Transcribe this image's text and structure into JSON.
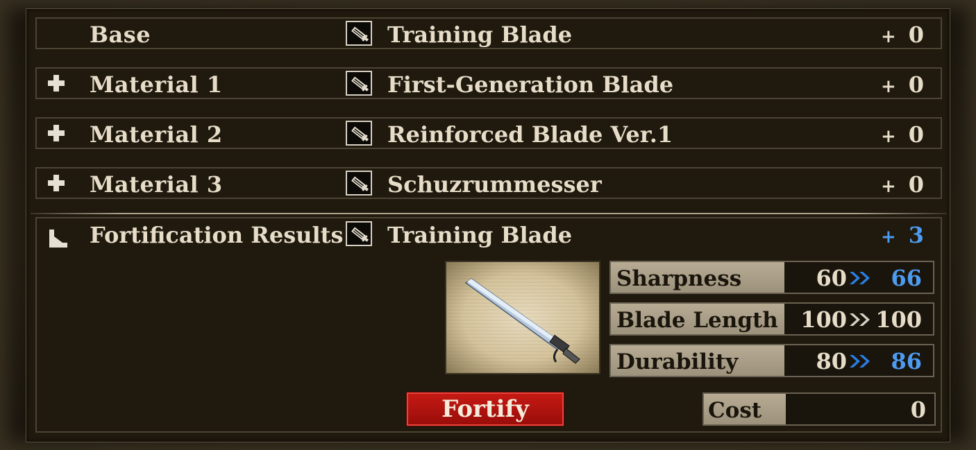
{
  "rows": [
    {
      "label": "Base",
      "name": "Training Blade",
      "plus": "+",
      "level": "0",
      "has_plus_icon": false
    },
    {
      "label": "Material 1",
      "name": "First-Generation Blade",
      "plus": "+",
      "level": "0",
      "has_plus_icon": true
    },
    {
      "label": "Material 2",
      "name": "Reinforced Blade Ver.1",
      "plus": "+",
      "level": "0",
      "has_plus_icon": true
    },
    {
      "label": "Material 3",
      "name": "Schuzrummesser",
      "plus": "+",
      "level": "0",
      "has_plus_icon": true
    }
  ],
  "result": {
    "label": "Fortification Results",
    "name": "Training Blade",
    "plus": "+",
    "level": "3"
  },
  "stats": [
    {
      "label": "Sharpness",
      "from": "60",
      "to": "66",
      "improved": true
    },
    {
      "label": "Blade Length",
      "from": "100",
      "to": "100",
      "improved": false
    },
    {
      "label": "Durability",
      "from": "80",
      "to": "86",
      "improved": true
    }
  ],
  "fortify_label": "Fortify",
  "cost": {
    "label": "Cost",
    "value": "0"
  },
  "colors": {
    "improved": "#4d9bf0",
    "neutral": "#e6dcc8",
    "button": "#b51410"
  },
  "icons": {
    "weapon": "blade-icon",
    "add": "plus-icon",
    "result": "corner-arrow-icon",
    "arrow": "double-chevron-icon"
  }
}
